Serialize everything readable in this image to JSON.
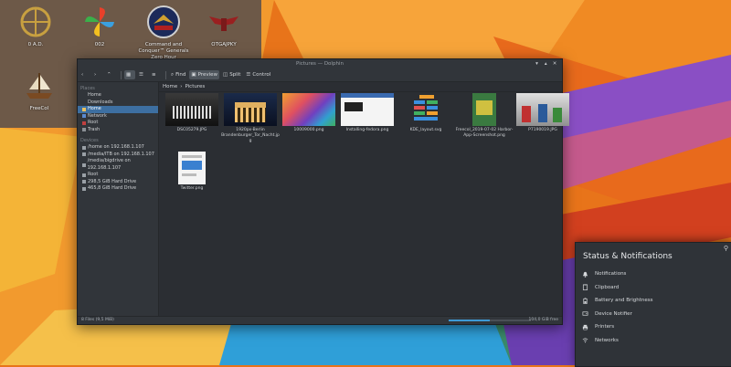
{
  "desktop": {
    "icons": [
      {
        "label": "0 A.D.",
        "icon": "zero-ad-icon"
      },
      {
        "label": "002",
        "icon": "pinwheel-icon"
      },
      {
        "label": "Command and Conquer™ Generals Zero Hour",
        "icon": "generals-icon"
      },
      {
        "label": "OTGAJPKY",
        "icon": "winged-emblem-icon"
      },
      {
        "label": "FreeCol",
        "icon": "ship-icon"
      }
    ]
  },
  "window": {
    "title": "Pictures — Dolphin",
    "toolbar": {
      "find": "Find",
      "preview": "Preview",
      "split": "Split",
      "control": "Control"
    },
    "places": {
      "places_header": "Places",
      "places": [
        "Home",
        "Downloads",
        "Home",
        "Network",
        "Root",
        "Trash"
      ],
      "selected_index": 2,
      "devices_header": "Devices",
      "devices": [
        "/home on 192.168.1.107",
        "/media/ITB on 192.168.1.107",
        "/media/bigdrive on 192.168.1.107",
        "Root",
        "298,5 GiB Hard Drive",
        "465,8 GiB Hard Drive"
      ]
    },
    "breadcrumb": [
      "Home",
      "Pictures"
    ],
    "files": [
      {
        "name": "DSC05279.JPG"
      },
      {
        "name": "1920px-Berlin Brandenburger_Tor_Nacht.jpg"
      },
      {
        "name": "10009000.png"
      },
      {
        "name": "Installing-fedora.png"
      },
      {
        "name": "KDE_layout.svg"
      },
      {
        "name": "Freecol_2019-07-02 Harbor-App-Screenshot.png"
      },
      {
        "name": "P7190019.JPG"
      },
      {
        "name": "Twitter.png"
      }
    ],
    "status": {
      "left": "8 Files (9,5 MiB)",
      "free": "104,0 GiB free",
      "used_fraction": 0.5
    }
  },
  "notifications": {
    "title": "Status & Notifications",
    "items": [
      {
        "label": "Notifications",
        "icon": "bell-icon"
      },
      {
        "label": "Clipboard",
        "icon": "clipboard-icon"
      },
      {
        "label": "Battery and Brightness",
        "icon": "battery-icon"
      },
      {
        "label": "Device Notifier",
        "icon": "device-icon"
      },
      {
        "label": "Printers",
        "icon": "printer-icon"
      },
      {
        "label": "Networks",
        "icon": "network-icon"
      }
    ]
  },
  "colors": {
    "accent": "#3d6fa1",
    "window_bg": "#2f3237",
    "wallpaper_orange": "#e8741a"
  }
}
